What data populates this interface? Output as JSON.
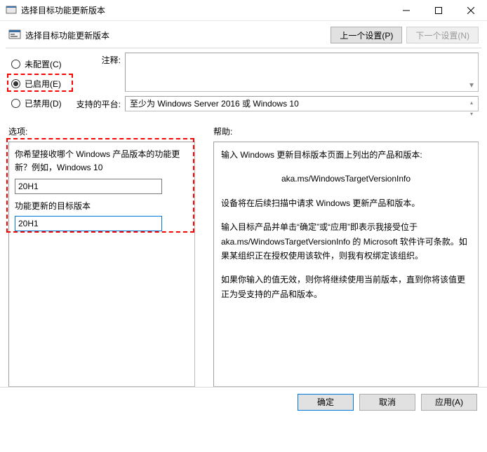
{
  "window": {
    "title": "选择目标功能更新版本"
  },
  "header": {
    "title": "选择目标功能更新版本",
    "prev": "上一个设置(P)",
    "next": "下一个设置(N)"
  },
  "radios": {
    "not_configured": "未配置(C)",
    "enabled": "已启用(E)",
    "disabled": "已禁用(D)"
  },
  "upper": {
    "comment_label": "注释:",
    "platform_label": "支持的平台:",
    "platform_value": "至少为 Windows Server 2016 或 Windows 10"
  },
  "mid": {
    "options_label": "选项:",
    "help_label": "帮助:"
  },
  "options": {
    "product_label": "你希望接收哪个 Windows 产品版本的功能更新？例如，Windows 10",
    "product_value": "20H1",
    "target_label": "功能更新的目标版本",
    "target_value": "20H1"
  },
  "help": {
    "p1": "输入 Windows 更新目标版本页面上列出的产品和版本:",
    "link": "aka.ms/WindowsTargetVersionInfo",
    "p2": "设备将在后续扫描中请求 Windows 更新产品和版本。",
    "p3": "输入目标产品并单击“确定”或“应用”即表示我接受位于 aka.ms/WindowsTargetVersionInfo 的 Microsoft 软件许可条款。如果某组织正在授权使用该软件，则我有权绑定该组织。",
    "p4": "如果你输入的值无效，则你将继续使用当前版本，直到你将该值更正为受支持的产品和版本。"
  },
  "footer": {
    "ok": "确定",
    "cancel": "取消",
    "apply": "应用(A)"
  }
}
